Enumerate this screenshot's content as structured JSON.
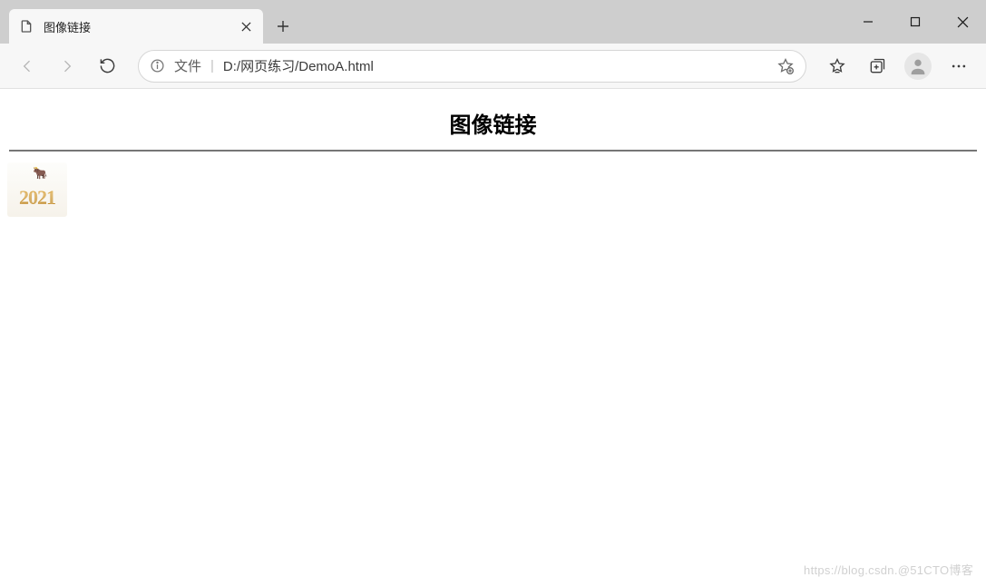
{
  "browser": {
    "tab": {
      "title": "图像链接"
    },
    "address": {
      "scheme_label": "文件",
      "url": "D:/网页练习/DemoA.html"
    }
  },
  "page": {
    "heading": "图像链接",
    "image": {
      "year_text": "2021",
      "deco": "🐂"
    }
  },
  "watermark": "https://blog.csdn.@51CTO博客"
}
